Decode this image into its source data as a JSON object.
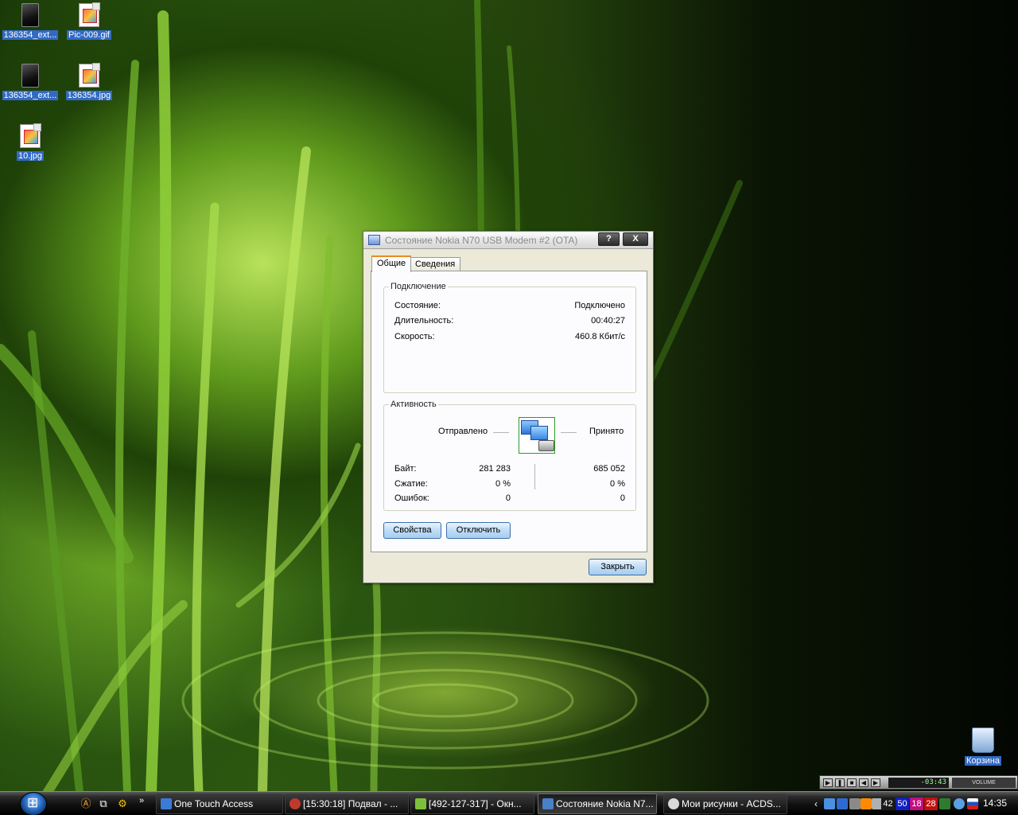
{
  "desktop": {
    "icons": [
      {
        "label": "136354_ext..."
      },
      {
        "label": "Pic-009.gif"
      },
      {
        "label": "136354_ext..."
      },
      {
        "label": "136354.jpg"
      },
      {
        "label": "10.jpg"
      }
    ],
    "recycle_bin": "Корзина"
  },
  "dialog": {
    "title": "Состояние Nokia N70 USB Modem #2 (OTA)",
    "help_btn": "?",
    "close_btn": "X",
    "tabs": [
      "Общие",
      "Сведения"
    ],
    "connection": {
      "group_label": "Подключение",
      "status_label": "Состояние:",
      "status_value": "Подключено",
      "duration_label": "Длительность:",
      "duration_value": "00:40:27",
      "speed_label": "Скорость:",
      "speed_value": "460.8 Кбит/с"
    },
    "activity": {
      "group_label": "Активность",
      "sent_label": "Отправлено",
      "received_label": "Принято",
      "bytes_label": "Байт:",
      "bytes_sent": "281 283",
      "bytes_received": "685 052",
      "compression_label": "Сжатие:",
      "compression_sent": "0 %",
      "compression_received": "0 %",
      "errors_label": "Ошибок:",
      "errors_sent": "0",
      "errors_received": "0"
    },
    "properties_btn": "Свойства",
    "disconnect_btn": "Отключить",
    "ok_btn": "Закрыть"
  },
  "player": {
    "time": "-03:43",
    "volume": "VOLUME"
  },
  "taskbar": {
    "items": [
      {
        "label": "One Touch Access",
        "color": "#3a7bd5"
      },
      {
        "label": "[15:30:18] Подвал - ...",
        "color": "#c0392b"
      },
      {
        "label": "[492-127-317] - Окн...",
        "color": "#7cbf3a"
      },
      {
        "label": "Состояние Nokia N7...",
        "color": "#4a7fc9"
      },
      {
        "label": "Мои рисунки - ACDS...",
        "color": "#d9d9d9"
      }
    ],
    "tray_numbers": [
      "42",
      "50",
      "18",
      "28"
    ],
    "tray_colors": [
      "#1a1a1a",
      "#1020c0",
      "#c01080",
      "#c01010"
    ],
    "clock": "14:35"
  }
}
